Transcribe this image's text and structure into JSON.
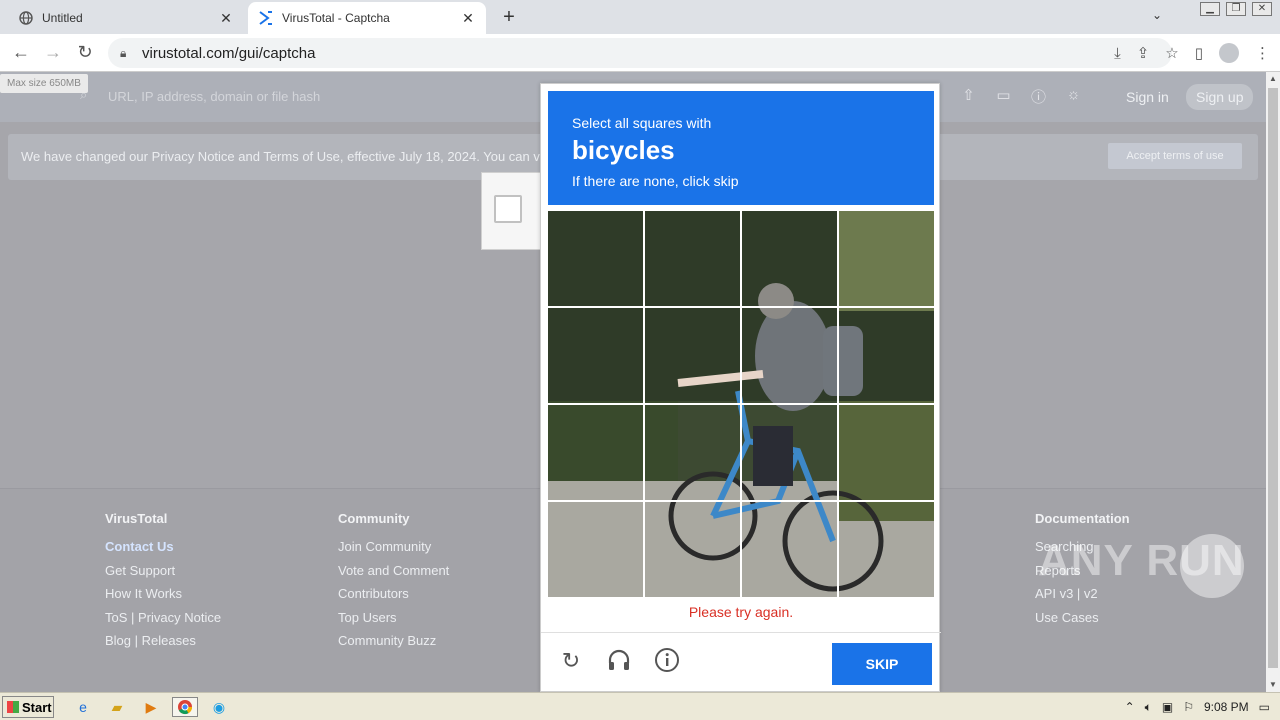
{
  "browser": {
    "tabs": [
      {
        "title": "Untitled",
        "favicon": "globe-icon"
      },
      {
        "title": "VirusTotal - Captcha",
        "favicon": "virustotal-icon"
      }
    ],
    "url": "virustotal.com/gui/captcha"
  },
  "vt": {
    "max_size": "Max size 650MB",
    "search_placeholder": "URL, IP address, domain or file hash",
    "sign_in": "Sign in",
    "sign_up": "Sign up",
    "notice": "We have changed our Privacy Notice and Terms of Use, effective July 18, 2024. You can v",
    "accept_terms": "Accept terms of use"
  },
  "footer": {
    "col1": {
      "heading": "VirusTotal",
      "links": [
        "Contact Us",
        "Get Support",
        "How It Works",
        "ToS | Privacy Notice",
        "Blog | Releases"
      ]
    },
    "col2": {
      "heading": "Community",
      "links": [
        "Join Community",
        "Vote and Comment",
        "Contributors",
        "Top Users",
        "Community Buzz"
      ]
    },
    "col3": {
      "heading": "Documentation",
      "links": [
        "Searching",
        "Reports",
        "API v3 | v2",
        "Use Cases"
      ]
    }
  },
  "captcha": {
    "line1": "Select all squares with",
    "target": "bicycles",
    "line3": "If there are none, click skip",
    "error": "Please try again.",
    "skip": "SKIP",
    "grid_rows": 4,
    "grid_cols": 4
  },
  "watermark": "ANY RUN",
  "taskbar": {
    "start": "Start",
    "time": "9:08 PM"
  }
}
